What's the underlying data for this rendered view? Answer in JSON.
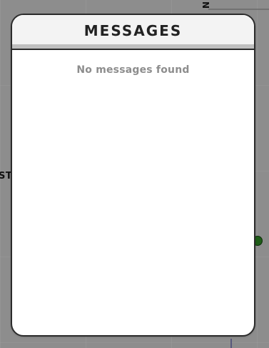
{
  "background": {
    "top_right_label": "N",
    "left_label": "ST",
    "accent_dot_color": "#1f5d18"
  },
  "messages": {
    "title": "MESSAGES",
    "empty_state": "No messages found"
  }
}
